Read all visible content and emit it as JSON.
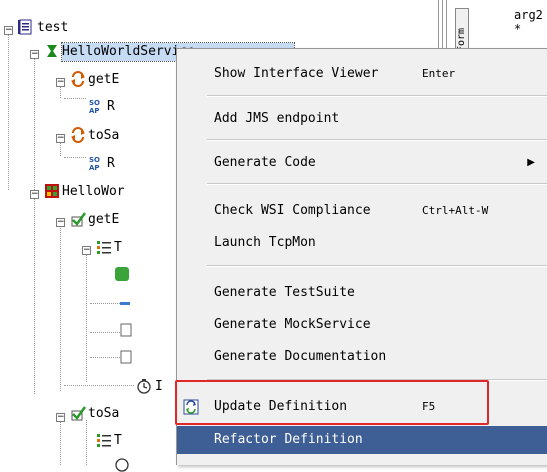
{
  "tree": {
    "root_label": "test",
    "nodes": [
      {
        "label": "HelloWorldService",
        "visible": "HelloWor"
      },
      {
        "label": "getE",
        "visible": "getE"
      },
      {
        "label": "R",
        "visible": "R"
      },
      {
        "label": "toSa",
        "visible": "toSa"
      },
      {
        "label": "R",
        "visible": "R"
      },
      {
        "label": "HelloWor",
        "visible": "HelloWor"
      },
      {
        "label": "getE",
        "visible": "getE"
      },
      {
        "label": "T",
        "visible": "T"
      },
      {
        "label": "I",
        "visible": "I"
      },
      {
        "label": "toSa",
        "visible": "toSa"
      },
      {
        "label": "T",
        "visible": "T"
      }
    ]
  },
  "panel": {
    "tab_label": "Form",
    "arg_text": "arg2 *"
  },
  "menu": {
    "items": [
      {
        "label": "Show Interface Viewer",
        "shortcut": "Enter"
      },
      {
        "label": "Add JMS endpoint",
        "shortcut": ""
      },
      {
        "label": "Generate Code",
        "shortcut": "",
        "submenu_arrow": "▶"
      },
      {
        "label": "Check WSI Compliance",
        "shortcut": "Ctrl+Alt-W"
      },
      {
        "label": "Launch TcpMon",
        "shortcut": ""
      },
      {
        "label": "Generate TestSuite",
        "shortcut": ""
      },
      {
        "label": "Generate MockService",
        "shortcut": ""
      },
      {
        "label": "Generate Documentation",
        "shortcut": ""
      },
      {
        "label": "Update Definition",
        "shortcut": "F5"
      },
      {
        "label": "Refactor Definition",
        "shortcut": ""
      }
    ],
    "highlighted_item": "Refactor Definition"
  },
  "colors": {
    "menu_bg": "#f0f0f0",
    "highlight": "#3d5f95",
    "annotation_red": "#e02828",
    "selection": "#c6dbf4"
  }
}
